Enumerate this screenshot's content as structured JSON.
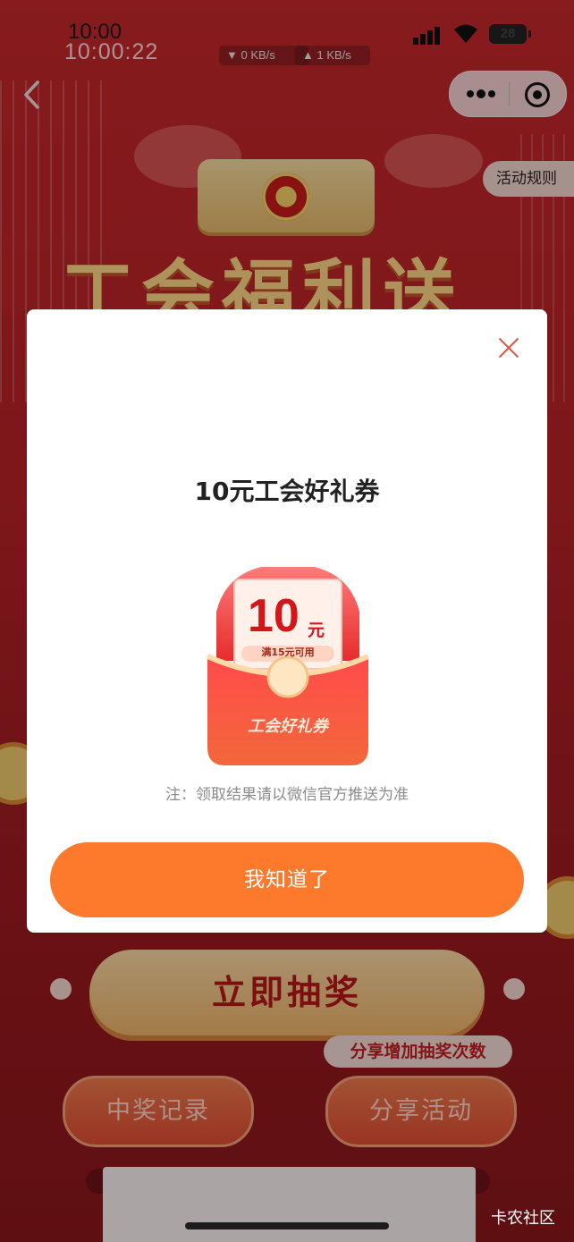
{
  "status_bar": {
    "time_top": "10:00",
    "time": "10:00:22",
    "net_down": "▼ 0 KB/s",
    "net_up": "▲ 1 KB/s",
    "battery": "28"
  },
  "header": {
    "rules_label": "活动规则",
    "banner_title": "工会福利送"
  },
  "modal": {
    "title": "10元工会好礼券",
    "coupon": {
      "amount": "10",
      "unit": "元",
      "condition": "满15元可用",
      "envelope_label": "工会好礼券"
    },
    "note": "注：领取结果请以微信官方推送为准",
    "confirm_label": "我知道了"
  },
  "page": {
    "draw_label": "立即抽奖",
    "share_tip": "分享增加抽奖次数",
    "records_label": "中奖记录",
    "share_label": "分享活动"
  },
  "watermark": "卡农社区",
  "colors": {
    "theme_red": "#c7282c",
    "button_orange": "#fd7a2c",
    "close_red": "#e0533e"
  }
}
